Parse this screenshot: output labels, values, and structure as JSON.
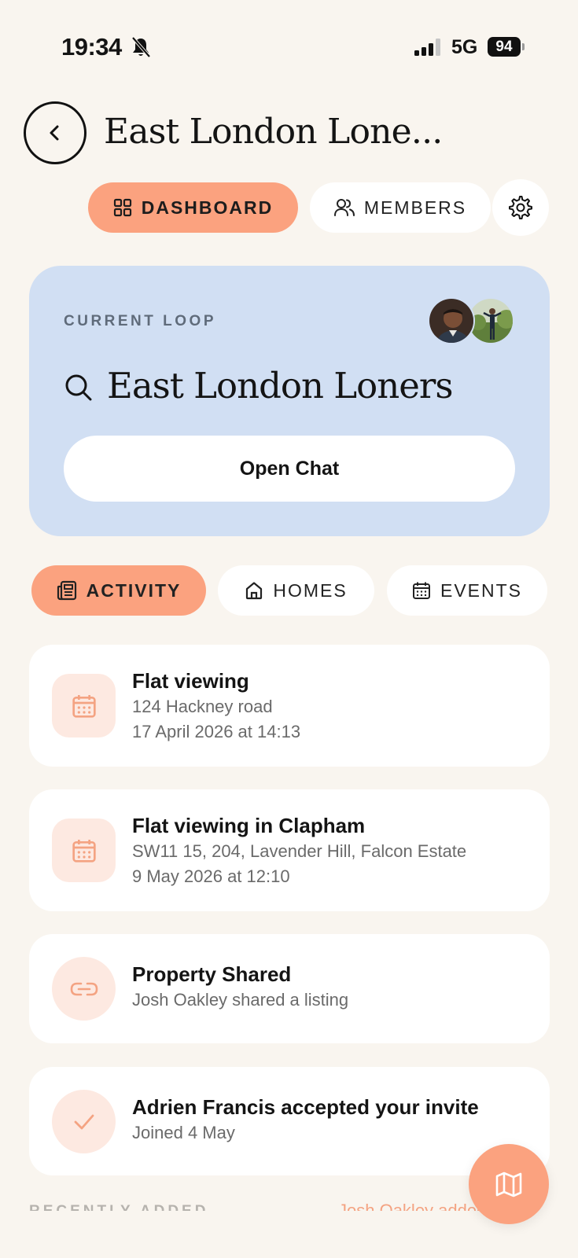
{
  "status_bar": {
    "time": "19:34",
    "network": "5G",
    "battery": "94"
  },
  "header": {
    "title": "East London Lone..."
  },
  "top_tabs": {
    "dashboard": "DASHBOARD",
    "members": "MEMBERS"
  },
  "loop_card": {
    "label": "CURRENT LOOP",
    "name": "East London Loners",
    "open_chat": "Open Chat"
  },
  "sub_tabs": {
    "activity": "ACTIVITY",
    "homes": "HOMES",
    "events": "EVENTS"
  },
  "activity": [
    {
      "icon": "calendar-icon",
      "title": "Flat viewing",
      "line1": "124 Hackney road",
      "line2": "17 April 2026 at 14:13"
    },
    {
      "icon": "calendar-icon",
      "title": "Flat viewing in Clapham",
      "line1": "SW11 15, 204, Lavender Hill, Falcon Estate",
      "line2": "9 May 2026 at 12:10"
    },
    {
      "icon": "link-icon",
      "title": "Property Shared",
      "line1": "Josh Oakley shared a listing"
    },
    {
      "icon": "check-icon",
      "title": "Adrien Francis accepted your invite",
      "line1": "Joined 4 May"
    }
  ],
  "recent": {
    "label": "RECENTLY ADDED",
    "link": "Josh Oakley added a h"
  },
  "colors": {
    "background": "#f9f5ef",
    "accent": "#fba27f",
    "loop_card": "#d1dff3",
    "icon_tint": "#fde9e1",
    "icon_stroke": "#f4a382"
  }
}
